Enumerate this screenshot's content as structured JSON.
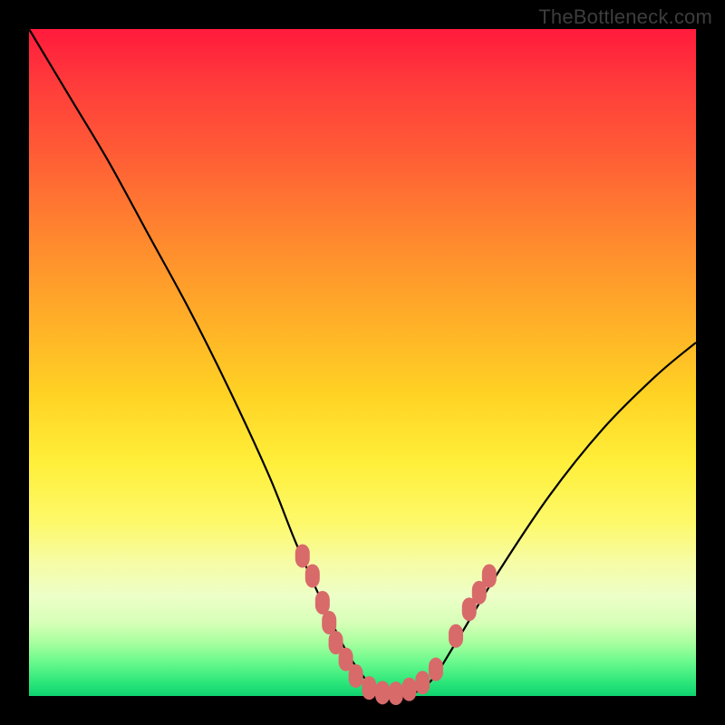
{
  "watermark": "TheBottleneck.com",
  "chart_data": {
    "type": "line",
    "title": "",
    "xlabel": "",
    "ylabel": "",
    "xlim": [
      0,
      100
    ],
    "ylim": [
      0,
      100
    ],
    "series": [
      {
        "name": "bottleneck-curve",
        "x": [
          0,
          6,
          12,
          18,
          24,
          30,
          36,
          40,
          44,
          48,
          52,
          56,
          60,
          64,
          70,
          78,
          86,
          94,
          100
        ],
        "y": [
          100,
          90,
          80,
          69,
          58,
          46,
          33,
          23,
          14,
          6,
          1,
          0,
          2,
          8,
          18,
          30,
          40,
          48,
          53
        ]
      }
    ],
    "markers": {
      "name": "highlighted-points",
      "color": "#d86a6a",
      "points": [
        {
          "x": 41,
          "y": 21
        },
        {
          "x": 42.5,
          "y": 18
        },
        {
          "x": 44,
          "y": 14
        },
        {
          "x": 45,
          "y": 11
        },
        {
          "x": 46,
          "y": 8
        },
        {
          "x": 47.5,
          "y": 5.5
        },
        {
          "x": 49,
          "y": 3
        },
        {
          "x": 51,
          "y": 1.2
        },
        {
          "x": 53,
          "y": 0.5
        },
        {
          "x": 55,
          "y": 0.4
        },
        {
          "x": 57,
          "y": 1
        },
        {
          "x": 59,
          "y": 2
        },
        {
          "x": 61,
          "y": 4
        },
        {
          "x": 64,
          "y": 9
        },
        {
          "x": 66,
          "y": 13
        },
        {
          "x": 67.5,
          "y": 15.5
        },
        {
          "x": 69,
          "y": 18
        }
      ]
    },
    "background_gradient": {
      "top": "#ff1a3c",
      "mid": "#ffe13a",
      "bottom": "#0ed36f"
    }
  }
}
